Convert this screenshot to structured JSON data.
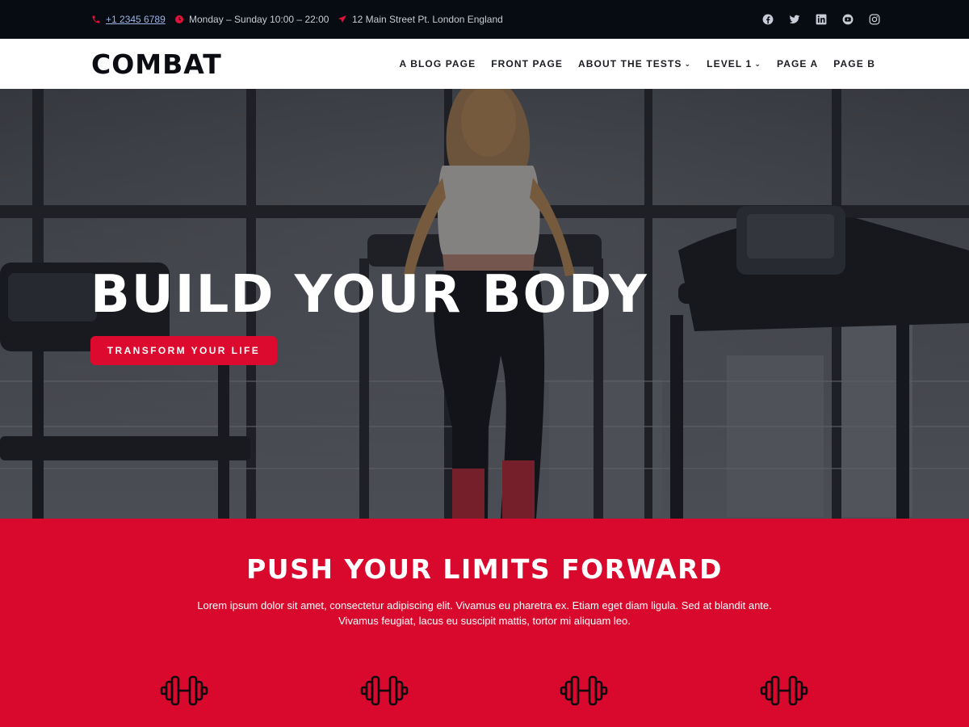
{
  "topbar": {
    "phone": "+1 2345 6789",
    "hours": "Monday – Sunday 10:00 – 22:00",
    "address": "12 Main Street Pt. London England",
    "socials": [
      "facebook-icon",
      "twitter-icon",
      "linkedin-icon",
      "youtube-icon",
      "instagram-icon"
    ]
  },
  "header": {
    "logo": "COMBAT",
    "nav": [
      {
        "label": "A BLOG PAGE",
        "dropdown": false
      },
      {
        "label": "FRONT PAGE",
        "dropdown": false
      },
      {
        "label": "ABOUT THE TESTS",
        "dropdown": true
      },
      {
        "label": "LEVEL 1",
        "dropdown": true
      },
      {
        "label": "PAGE A",
        "dropdown": false
      },
      {
        "label": "PAGE B",
        "dropdown": false
      }
    ]
  },
  "hero": {
    "title": "BUILD YOUR BODY",
    "button": "TRANSFORM YOUR LIFE"
  },
  "section": {
    "title": "PUSH YOUR LIMITS FORWARD",
    "text_line1": "Lorem ipsum dolor sit amet, consectetur adipiscing elit. Vivamus eu pharetra ex. Etiam eget diam ligula. Sed at blandit ante.",
    "text_line2": "Vivamus feugiat, lacus eu suscipit mattis, tortor mi aliquam leo.",
    "feature_icons": [
      "dumbbell-icon",
      "dumbbell-icon",
      "dumbbell-icon",
      "dumbbell-icon"
    ]
  },
  "colors": {
    "accent": "#d9082d",
    "topbar_bg": "#070b12",
    "header_bg": "#ffffff"
  }
}
